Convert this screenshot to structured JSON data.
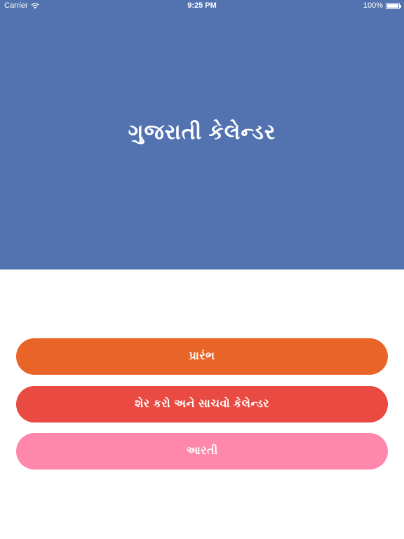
{
  "status_bar": {
    "carrier": "Carrier",
    "time": "9:25 PM",
    "battery": "100%"
  },
  "header": {
    "title": "ગુજરાતી કેલેન્ડર",
    "background": "#5273b0"
  },
  "buttons": [
    {
      "label": "પ્રારંભ",
      "color": "#e96527"
    },
    {
      "label": "શેર કરો અને સાચવો કેલેન્ડર",
      "color": "#e94b42"
    },
    {
      "label": "આરતી",
      "color": "#ff87ac"
    }
  ]
}
